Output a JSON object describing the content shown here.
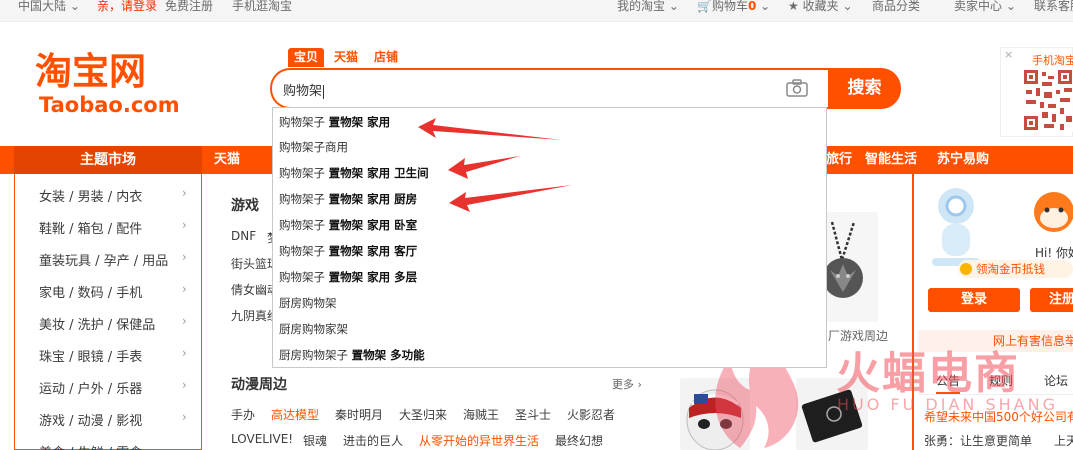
{
  "topbar": {
    "region": "中国大陆",
    "login": "亲，请登录",
    "register": "免费注册",
    "mobile": "手机逛淘宝",
    "my_taobao": "我的淘宝",
    "cart": "购物车",
    "cart_count": "0",
    "favorites": "收藏夹",
    "categories": "商品分类",
    "seller_center": "卖家中心",
    "contact": "联系客服"
  },
  "logo": {
    "cn": "淘宝网",
    "en": "Taobao.com"
  },
  "search": {
    "tabs": [
      "宝贝",
      "天猫",
      "店铺"
    ],
    "query": "购物架",
    "button": "搜索",
    "suggestions": [
      {
        "pre": "购物架子 ",
        "bold": "置物架 家用"
      },
      {
        "pre": "购物架子商用",
        "bold": ""
      },
      {
        "pre": "购物架子 ",
        "bold": "置物架 家用 卫生间"
      },
      {
        "pre": "购物架子 ",
        "bold": "置物架 家用 厨房"
      },
      {
        "pre": "购物架子 ",
        "bold": "置物架 家用 卧室"
      },
      {
        "pre": "购物架子 ",
        "bold": "置物架 家用 客厅"
      },
      {
        "pre": "购物架子 ",
        "bold": "置物架 家用 多层"
      },
      {
        "pre": "厨房购物架",
        "bold": ""
      },
      {
        "pre": "厨房购物家架",
        "bold": ""
      },
      {
        "pre": "厨房购物架子 ",
        "bold": "置物架 多功能"
      }
    ]
  },
  "qr": {
    "label": "手机淘宝",
    "close": "×"
  },
  "nav": {
    "theme": "主题市场",
    "items": [
      "天猫",
      "旅行",
      "智能生活",
      "苏宁易购"
    ]
  },
  "left_menu": [
    "女装 / 男装 / 内衣",
    "鞋靴 / 箱包 / 配件",
    "童装玩具 / 孕产 / 用品",
    "家电 / 数码 / 手机",
    "美妆 / 洗护 / 保健品",
    "珠宝 / 眼镜 / 手表",
    "运动 / 户外 / 乐器",
    "游戏 / 动漫 / 影视",
    "美食 / 生鲜 / 零食"
  ],
  "games": {
    "title": "游戏",
    "tags": [
      "DNF",
      "梦",
      "街头篮球",
      "倩女幽魂",
      "九阴真经"
    ]
  },
  "anime": {
    "title": "动漫周边",
    "more": "更多",
    "tags": [
      {
        "text": "手办",
        "hot": false
      },
      {
        "text": "高达模型",
        "hot": true
      },
      {
        "text": "秦时明月",
        "hot": false
      },
      {
        "text": "大圣归来",
        "hot": false
      },
      {
        "text": "海贼王",
        "hot": false
      },
      {
        "text": "圣斗士",
        "hot": false
      },
      {
        "text": "火影忍者",
        "hot": false
      },
      {
        "text": "LOVELIVE!",
        "hot": false
      },
      {
        "text": "银魂",
        "hot": false
      },
      {
        "text": "进击的巨人",
        "hot": false
      },
      {
        "text": "从零开始的异世界生活",
        "hot": true
      },
      {
        "text": "最终幻想",
        "hot": false
      }
    ]
  },
  "products": {
    "caption": "厂游戏周边"
  },
  "right": {
    "greeting": "Hi! 你好",
    "coin": "领淘金币抵钱",
    "login": "登录",
    "register": "注册",
    "warning": "网上有害信息举报",
    "tabs": [
      "公告",
      "规则",
      "论坛"
    ],
    "notices": [
      "希望未来中国500个好公司有",
      "张勇：让生意更简单",
      "上天"
    ]
  },
  "watermark": {
    "main": "火蝠电商",
    "sub": "HUO FU DIAN SHANG"
  },
  "colors": {
    "brand": "#ff5000",
    "annotation": "#e8322d"
  }
}
